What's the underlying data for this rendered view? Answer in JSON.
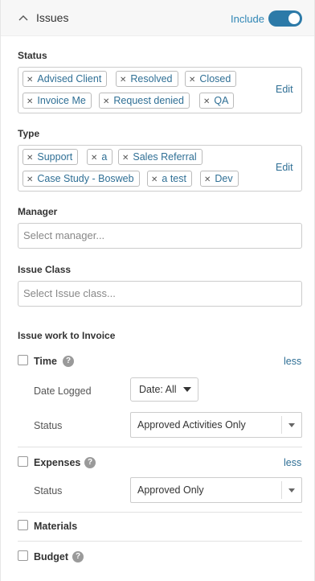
{
  "header": {
    "title": "Issues",
    "include_label": "Include",
    "include_on": true
  },
  "status": {
    "label": "Status",
    "tags": [
      "Advised Client",
      "Resolved",
      "Closed",
      "Invoice Me",
      "Request denied",
      "QA"
    ],
    "edit_label": "Edit"
  },
  "type": {
    "label": "Type",
    "tags": [
      "Support",
      "a",
      "Sales Referral",
      "Case Study - Bosweb",
      "a test",
      "Dev"
    ],
    "edit_label": "Edit"
  },
  "manager": {
    "label": "Manager",
    "placeholder": "Select manager..."
  },
  "issue_class": {
    "label": "Issue Class",
    "placeholder": "Select Issue class..."
  },
  "invoice": {
    "title": "Issue work to Invoice",
    "time": {
      "label": "Time",
      "less_label": "less",
      "date_logged_label": "Date Logged",
      "date_value": "Date: All",
      "status_label": "Status",
      "status_value": "Approved Activities Only"
    },
    "expenses": {
      "label": "Expenses",
      "less_label": "less",
      "status_label": "Status",
      "status_value": "Approved Only"
    },
    "materials": {
      "label": "Materials"
    },
    "budget": {
      "label": "Budget"
    },
    "help_glyph": "?"
  },
  "colors": {
    "accent": "#2c7aa8",
    "link": "#2f6f95"
  }
}
